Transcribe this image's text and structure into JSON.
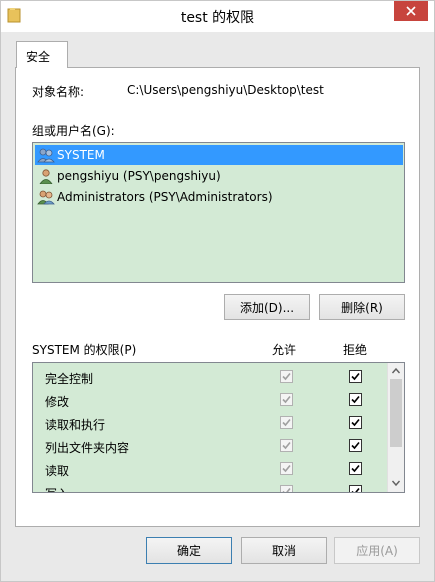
{
  "window": {
    "title": "test 的权限",
    "close_icon": "close-icon",
    "folder_icon": "folder-icon"
  },
  "tabs": [
    {
      "label": "安全"
    }
  ],
  "object": {
    "label": "对象名称:",
    "value": "C:\\Users\\pengshiyu\\Desktop\\test"
  },
  "groups": {
    "label": "组或用户名(G):",
    "items": [
      {
        "name": "SYSTEM",
        "icon": "group-icon",
        "selected": true
      },
      {
        "name": "pengshiyu (PSY\\pengshiyu)",
        "icon": "user-icon",
        "selected": false
      },
      {
        "name": "Administrators (PSY\\Administrators)",
        "icon": "group-icon",
        "selected": false
      }
    ]
  },
  "buttons": {
    "add": "添加(D)...",
    "remove": "删除(R)"
  },
  "permissions": {
    "label": "SYSTEM 的权限(P)",
    "allow_header": "允许",
    "deny_header": "拒绝",
    "rows": [
      {
        "name": "完全控制",
        "allow": true,
        "deny": true
      },
      {
        "name": "修改",
        "allow": true,
        "deny": true
      },
      {
        "name": "读取和执行",
        "allow": true,
        "deny": true
      },
      {
        "name": "列出文件夹内容",
        "allow": true,
        "deny": true
      },
      {
        "name": "读取",
        "allow": true,
        "deny": true
      },
      {
        "name": "写入",
        "allow": true,
        "deny": true
      }
    ]
  },
  "footer": {
    "ok": "确定",
    "cancel": "取消",
    "apply": "应用(A)"
  }
}
